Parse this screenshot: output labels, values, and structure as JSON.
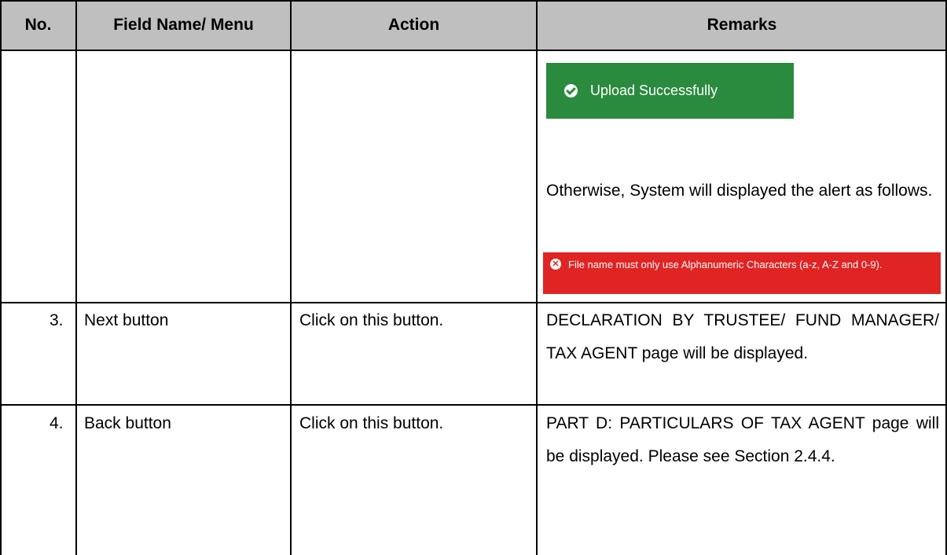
{
  "headers": {
    "no": "No.",
    "field": "Field Name/ Menu",
    "action": "Action",
    "remarks": "Remarks"
  },
  "continued_row": {
    "success_toast": {
      "icon": "check-circle-icon",
      "label": "Upload Successfully",
      "color": "#2a8a3e"
    },
    "remark_text": "Otherwise, System will displayed the alert as follows.",
    "error_toast": {
      "icon": "x-circle-icon",
      "message": "File name must only use Alphanumeric Characters (a-z, A-Z and 0-9).",
      "color": "#e02424"
    }
  },
  "rows": [
    {
      "no": "3.",
      "field": "Next button",
      "action": "Click on this button.",
      "remarks": "DECLARATION BY TRUSTEE/ FUND MANAGER/ TAX AGENT page will be displayed."
    },
    {
      "no": "4.",
      "field": "Back button",
      "action": "Click on this button.",
      "remarks": "PART D: PARTICULARS OF TAX AGENT page will be displayed. Please see Section 2.4.4."
    }
  ],
  "colors": {
    "header_bg": "#bfbfbf",
    "border": "#000000"
  }
}
